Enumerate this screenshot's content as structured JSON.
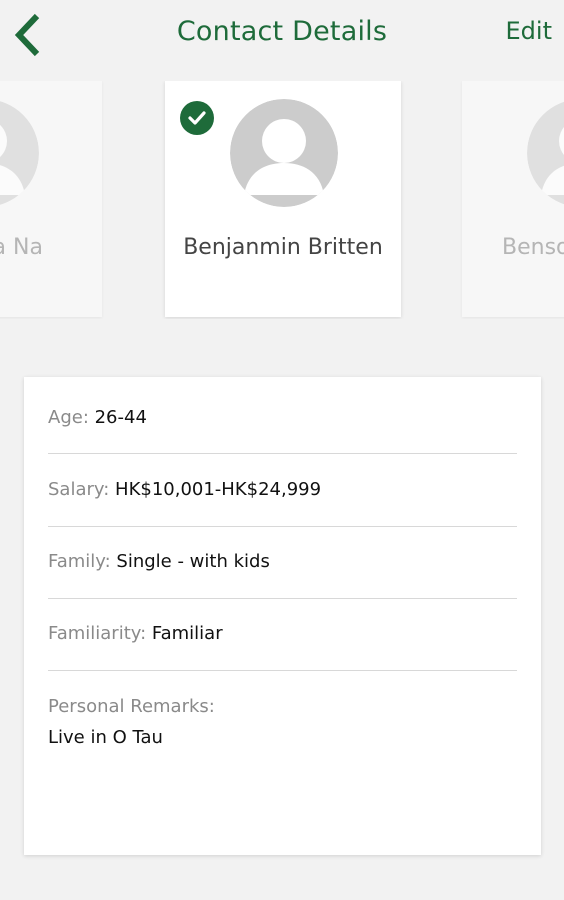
{
  "header": {
    "title": "Contact Details",
    "edit_label": "Edit",
    "back_icon": "chevron-left-icon"
  },
  "contacts": [
    {
      "name": "Bahasa Na\nan",
      "selected": false
    },
    {
      "name": "Benjanmin Britten",
      "selected": true
    },
    {
      "name": "Benso",
      "selected": false
    }
  ],
  "details": {
    "age_label": "Age: ",
    "age_value": "26-44",
    "salary_label": "Salary: ",
    "salary_value": "HK$10,001-HK$24,999",
    "family_label": "Family: ",
    "family_value": "Single - with kids",
    "familiarity_label": "Familiarity: ",
    "familiarity_value": "Familiar",
    "remarks_label": "Personal Remarks:",
    "remarks_value": "Live in O Tau"
  },
  "colors": {
    "brand_green": "#1e6b3a",
    "background": "#f2f2f2"
  }
}
